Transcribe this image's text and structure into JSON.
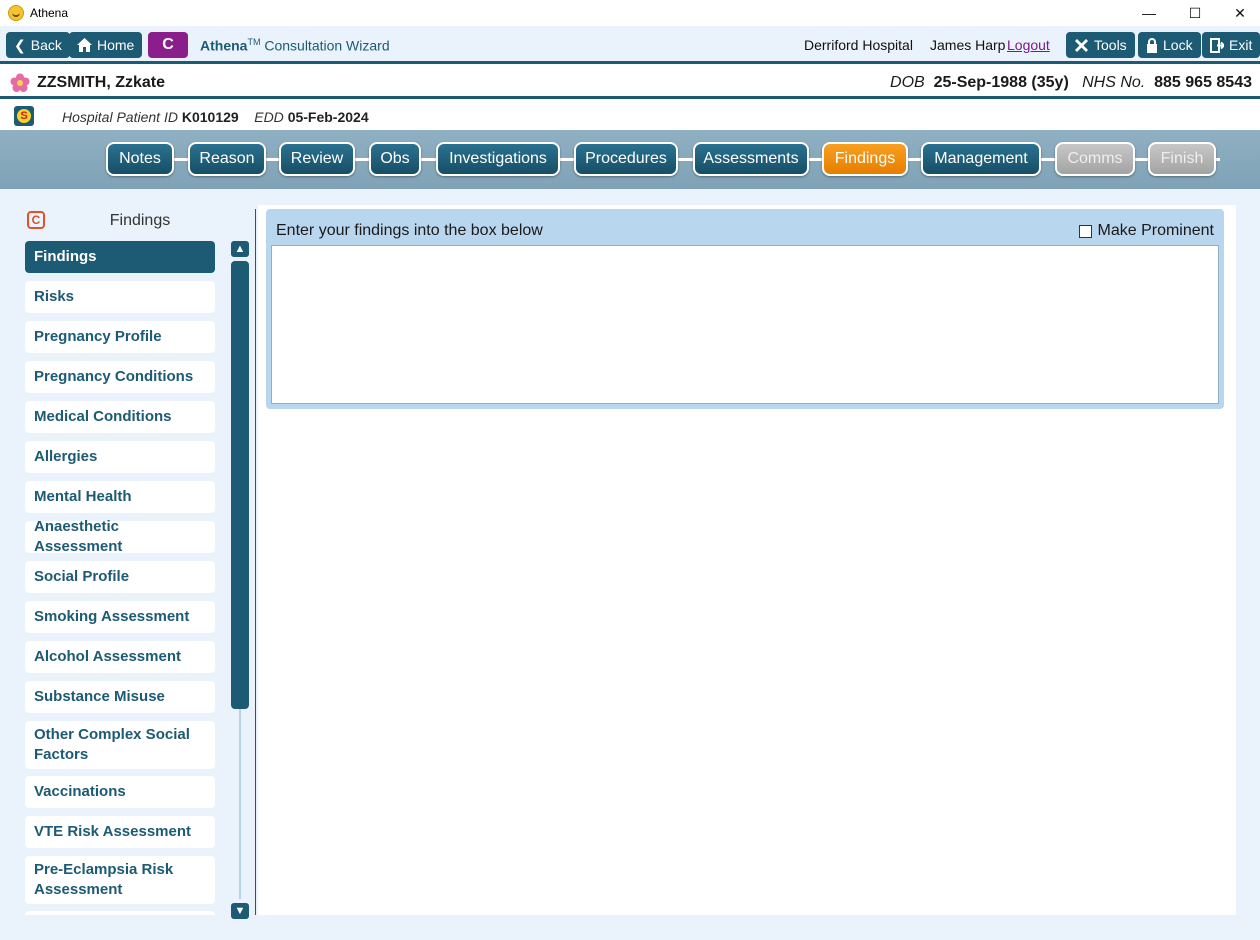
{
  "window": {
    "title": "Athena",
    "minimize_glyph": "—",
    "maximize_glyph": "☐",
    "close_glyph": "✕"
  },
  "toolbar": {
    "back_label": "Back",
    "home_label": "Home",
    "c_label": "C",
    "app_name": "Athena",
    "app_tm": "TM",
    "app_subtitle": "Consultation Wizard",
    "hospital": "Derriford Hospital",
    "user": "James Harp",
    "logout_label": "Logout",
    "tools_label": "Tools",
    "lock_label": "Lock",
    "exit_label": "Exit"
  },
  "patient": {
    "name": "ZZSMITH, Zzkate",
    "dob_label": "DOB",
    "dob_value": "25-Sep-1988 (35y)",
    "nhs_label": "NHS No.",
    "nhs_value": "885 965 8543",
    "hospital_id_label": "Hospital Patient ID",
    "hospital_id_value": "K010129",
    "edd_label": "EDD",
    "edd_value": "05-Feb-2024"
  },
  "steps": [
    {
      "label": "Notes",
      "state": "normal"
    },
    {
      "label": "Reason",
      "state": "normal"
    },
    {
      "label": "Review",
      "state": "normal"
    },
    {
      "label": "Obs",
      "state": "normal"
    },
    {
      "label": "Investigations",
      "state": "normal"
    },
    {
      "label": "Procedures",
      "state": "normal"
    },
    {
      "label": "Assessments",
      "state": "normal"
    },
    {
      "label": "Findings",
      "state": "active"
    },
    {
      "label": "Management",
      "state": "normal"
    },
    {
      "label": "Comms",
      "state": "disabled"
    },
    {
      "label": "Finish",
      "state": "disabled"
    }
  ],
  "sidebar": {
    "icon_letter": "C",
    "title": "Findings",
    "items": [
      "Findings",
      "Risks",
      "Pregnancy Profile",
      "Pregnancy Conditions",
      "Medical Conditions",
      "Allergies",
      "Mental Health",
      "Anaesthetic Assessment",
      "Social Profile",
      "Smoking Assessment",
      "Alcohol Assessment",
      "Substance Misuse",
      "Other Complex Social Factors",
      "Vaccinations",
      "VTE Risk Assessment",
      "Pre-Eclampsia Risk Assessment",
      ""
    ],
    "selected_index": 0
  },
  "findings": {
    "instruction": "Enter your findings into the box below",
    "make_prominent_label": "Make Prominent",
    "make_prominent_checked": false,
    "text": ""
  },
  "colors": {
    "primary": "#1d5a73",
    "active_step": "#f39200",
    "disabled_step": "#b0b0b0",
    "c_button": "#8a1e8a",
    "panel": "#b9d6ef"
  }
}
